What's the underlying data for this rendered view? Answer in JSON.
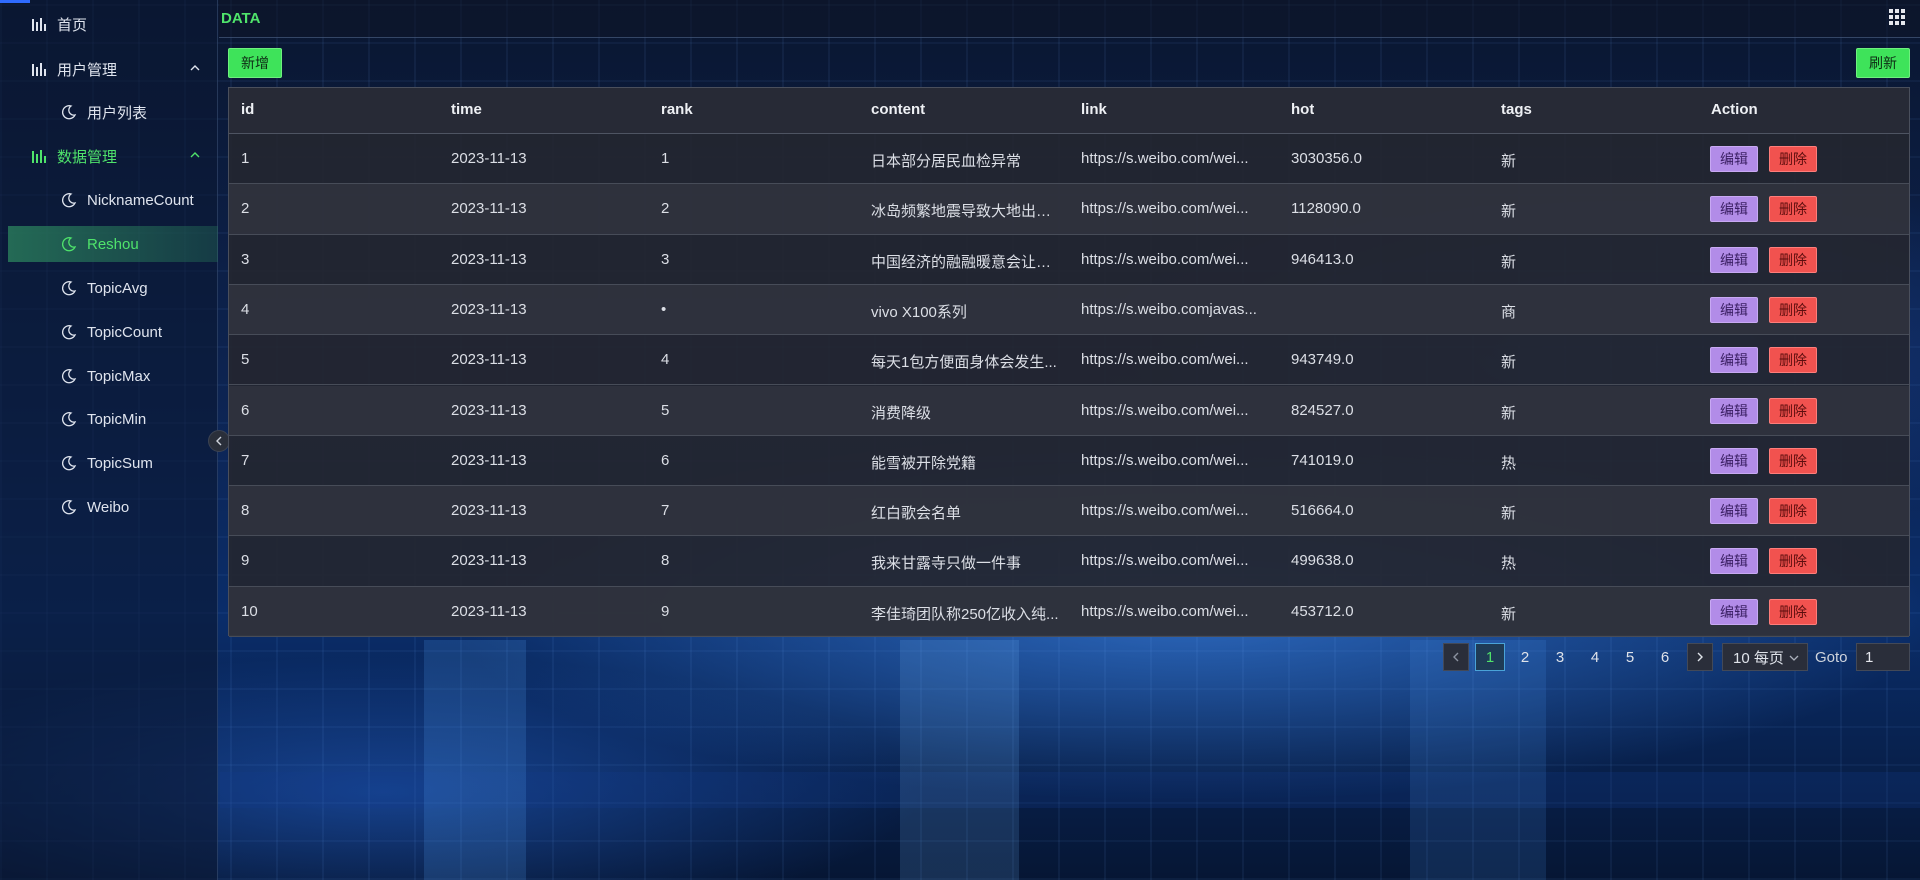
{
  "sidebar": {
    "items": [
      {
        "label": "首页",
        "icon": "bar-chart-icon"
      },
      {
        "label": "用户管理",
        "icon": "bar-chart-icon"
      },
      {
        "label": "用户列表",
        "icon": "moon-icon"
      },
      {
        "label": "数据管理",
        "icon": "bar-chart-icon"
      },
      {
        "label": "NicknameCount",
        "icon": "moon-icon"
      },
      {
        "label": "Reshou",
        "icon": "moon-icon"
      },
      {
        "label": "TopicAvg",
        "icon": "moon-icon"
      },
      {
        "label": "TopicCount",
        "icon": "moon-icon"
      },
      {
        "label": "TopicMax",
        "icon": "moon-icon"
      },
      {
        "label": "TopicMin",
        "icon": "moon-icon"
      },
      {
        "label": "TopicSum",
        "icon": "moon-icon"
      },
      {
        "label": "Weibo",
        "icon": "moon-icon"
      }
    ],
    "active_item": "Reshou",
    "active_color": "#4fe36b"
  },
  "header": {
    "title": "DATA",
    "apps_icon": "grid-icon"
  },
  "toolbar": {
    "add_label": "新增",
    "refresh_label": "刷新"
  },
  "table": {
    "columns": [
      "id",
      "time",
      "rank",
      "content",
      "link",
      "hot",
      "tags",
      "Action"
    ],
    "edit_label": "编辑",
    "delete_label": "删除",
    "rows": [
      {
        "id": "1",
        "time": "2023-11-13",
        "rank": "1",
        "content": "日本部分居民血检异常",
        "link": "https://s.weibo.com/wei...",
        "hot": "3030356.0",
        "tags": "新"
      },
      {
        "id": "2",
        "time": "2023-11-13",
        "rank": "2",
        "content": "冰岛频繁地震导致大地出现...",
        "link": "https://s.weibo.com/wei...",
        "hot": "1128090.0",
        "tags": "新"
      },
      {
        "id": "3",
        "time": "2023-11-13",
        "rank": "3",
        "content": "中国经济的融融暖意会让发...",
        "link": "https://s.weibo.com/wei...",
        "hot": "946413.0",
        "tags": "新"
      },
      {
        "id": "4",
        "time": "2023-11-13",
        "rank": "•",
        "content": "vivo X100系列",
        "link": "https://s.weibo.comjavas...",
        "hot": "",
        "tags": "商"
      },
      {
        "id": "5",
        "time": "2023-11-13",
        "rank": "4",
        "content": "每天1包方便面身体会发生...",
        "link": "https://s.weibo.com/wei...",
        "hot": "943749.0",
        "tags": "新"
      },
      {
        "id": "6",
        "time": "2023-11-13",
        "rank": "5",
        "content": "消费降级",
        "link": "https://s.weibo.com/wei...",
        "hot": "824527.0",
        "tags": "新"
      },
      {
        "id": "7",
        "time": "2023-11-13",
        "rank": "6",
        "content": "能雪被开除党籍",
        "link": "https://s.weibo.com/wei...",
        "hot": "741019.0",
        "tags": "热"
      },
      {
        "id": "8",
        "time": "2023-11-13",
        "rank": "7",
        "content": "红白歌会名单",
        "link": "https://s.weibo.com/wei...",
        "hot": "516664.0",
        "tags": "新"
      },
      {
        "id": "9",
        "time": "2023-11-13",
        "rank": "8",
        "content": "我来甘露寺只做一件事",
        "link": "https://s.weibo.com/wei...",
        "hot": "499638.0",
        "tags": "热"
      },
      {
        "id": "10",
        "time": "2023-11-13",
        "rank": "9",
        "content": "李佳琦团队称250亿收入纯...",
        "link": "https://s.weibo.com/wei...",
        "hot": "453712.0",
        "tags": "新"
      }
    ]
  },
  "pagination": {
    "pages": [
      "1",
      "2",
      "3",
      "4",
      "5",
      "6"
    ],
    "current_page": "1",
    "page_size_label": "10 每页",
    "goto_label": "Goto",
    "goto_value": "1"
  },
  "colors": {
    "accent_green": "#4fe36b",
    "edit_button": "#b28ce8",
    "delete_button": "#f1524f"
  }
}
